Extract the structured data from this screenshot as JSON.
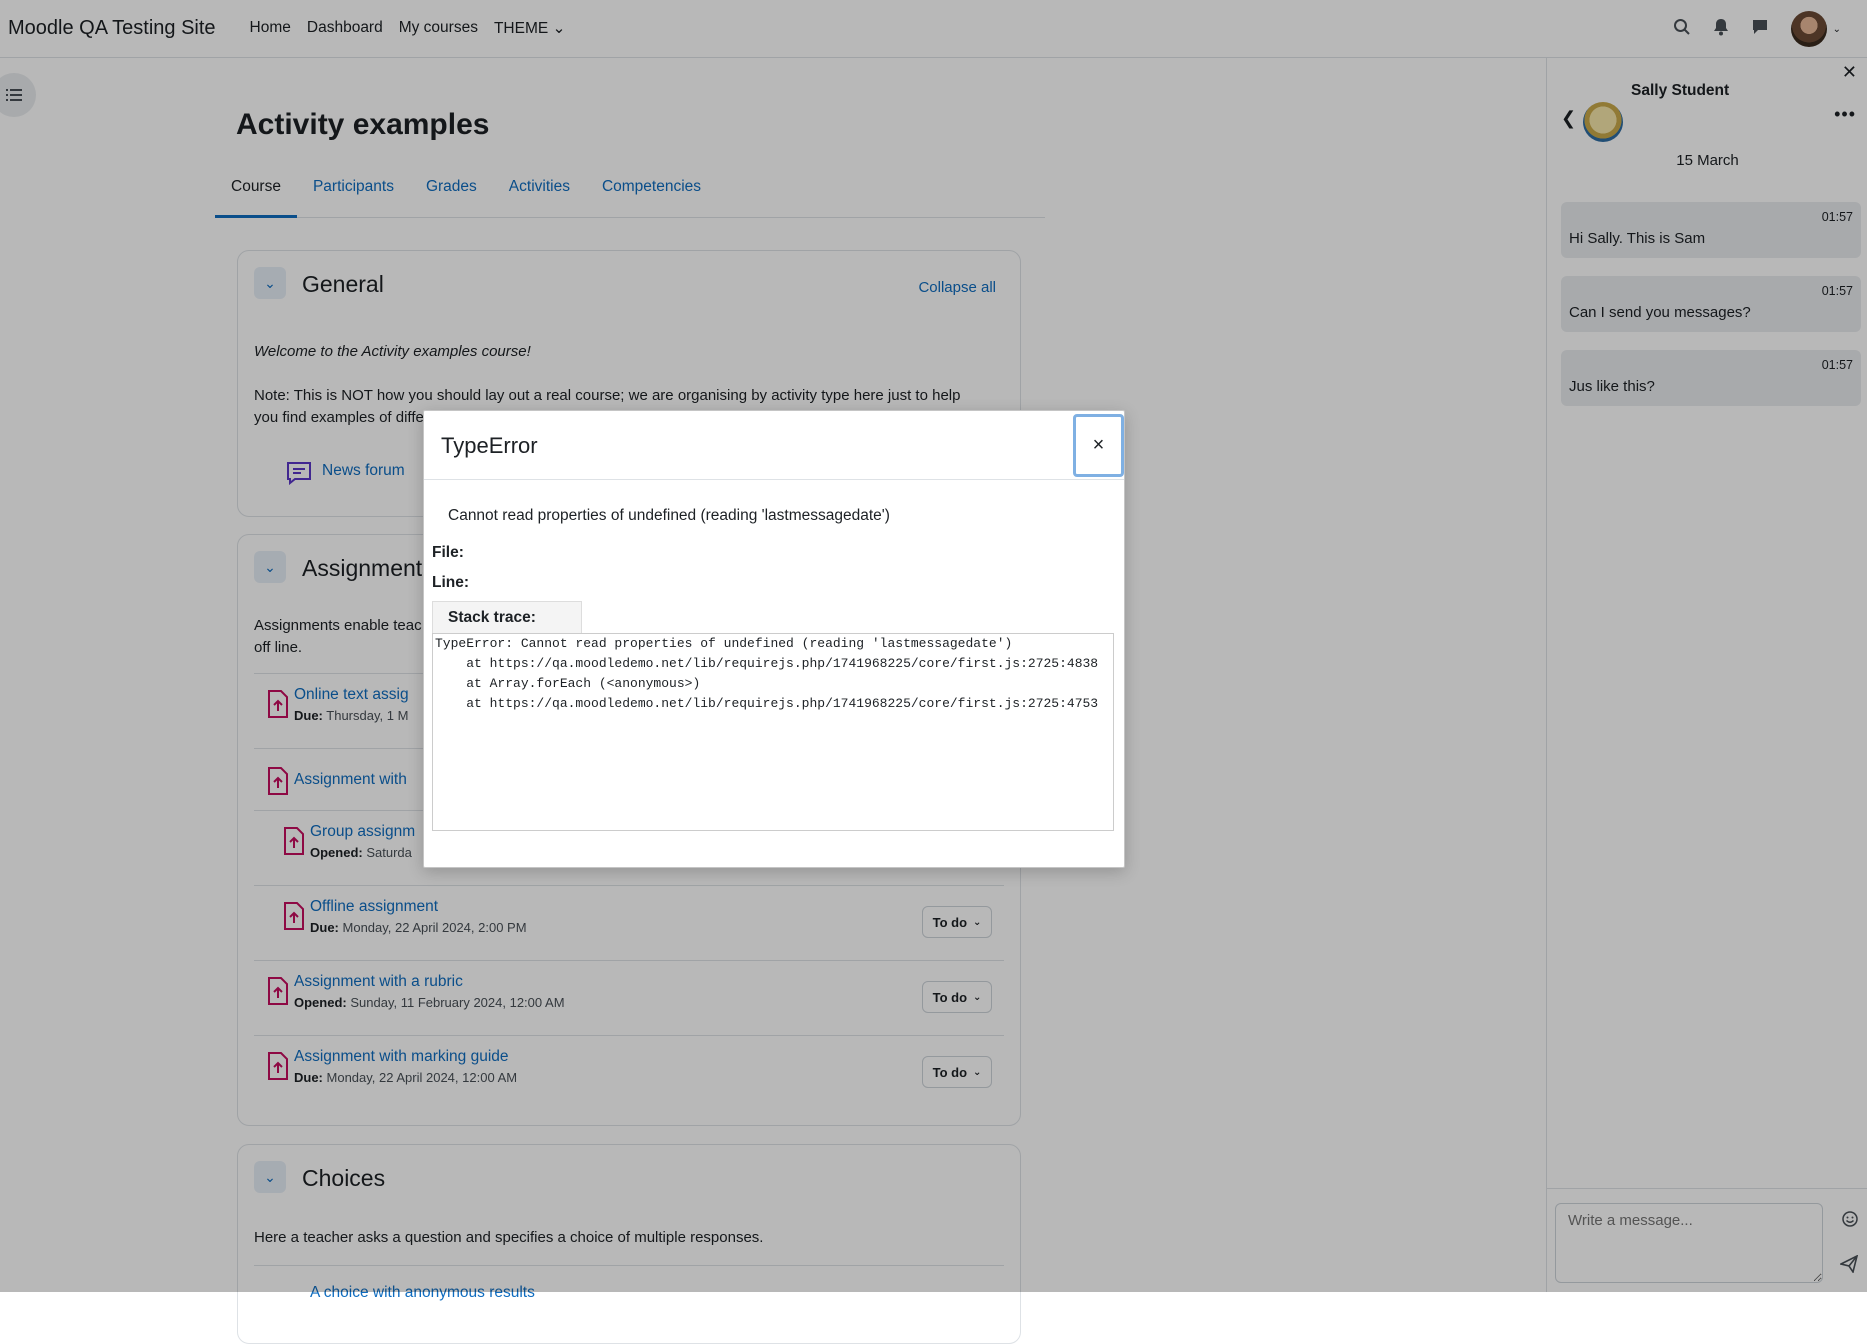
{
  "navbar": {
    "brand": "Moodle QA Testing Site",
    "links": [
      "Home",
      "Dashboard",
      "My courses",
      "THEME"
    ]
  },
  "course": {
    "title": "Activity examples",
    "tabs": [
      "Course",
      "Participants",
      "Grades",
      "Activities",
      "Competencies"
    ],
    "general": {
      "title": "General",
      "collapse_all": "Collapse all",
      "welcome": "Welcome to the Activity examples course!",
      "note_line1": "Note: This is NOT how you should lay out a real course; we are organising by activity type here just to help",
      "note_line2": "you find examples of diffe",
      "news_forum": "News forum"
    },
    "assignments": {
      "title": "Assignments",
      "desc_line1": "Assignments enable teac",
      "desc_line2": "off line.",
      "items": [
        {
          "name": "Online text assig",
          "date_label": "Due:",
          "date": "Thursday, 1 M"
        },
        {
          "name": "Assignment with",
          "date_label": "",
          "date": ""
        },
        {
          "name": "Group assignm",
          "date_label": "Opened:",
          "date": "Saturda"
        },
        {
          "name": "Offline assignment",
          "date_label": "Due:",
          "date": "Monday, 22 April 2024, 2:00 PM",
          "status": "To do"
        },
        {
          "name": "Assignment with a rubric",
          "date_label": "Opened:",
          "date": "Sunday, 11 February 2024, 12:00 AM",
          "status": "To do"
        },
        {
          "name": "Assignment with marking guide",
          "date_label": "Due:",
          "date": "Monday, 22 April 2024, 12:00 AM",
          "status": "To do"
        }
      ]
    },
    "choices": {
      "title": "Choices",
      "desc": "Here a teacher asks a question and specifies a choice of multiple responses.",
      "first_item": "A choice with anonymous results"
    }
  },
  "messaging": {
    "contact_name": "Sally Student",
    "date": "15 March",
    "messages": [
      {
        "time": "01:57",
        "text": "Hi Sally. This is Sam"
      },
      {
        "time": "01:57",
        "text": "Can I send you messages?"
      },
      {
        "time": "01:57",
        "text": "Jus like this?"
      }
    ],
    "input_placeholder": "Write a message..."
  },
  "modal": {
    "title": "TypeError",
    "close": "×",
    "message": "Cannot read properties of undefined (reading 'lastmessagedate')",
    "file_label": "File:",
    "line_label": "Line:",
    "stack_label": "Stack trace:",
    "stack_trace": "TypeError: Cannot read properties of undefined (reading 'lastmessagedate')\n    at https://qa.moodledemo.net/lib/requirejs.php/1741968225/core/first.js:2725:4838\n    at Array.forEach (<anonymous>)\n    at https://qa.moodledemo.net/lib/requirejs.php/1741968225/core/first.js:2725:4753"
  }
}
